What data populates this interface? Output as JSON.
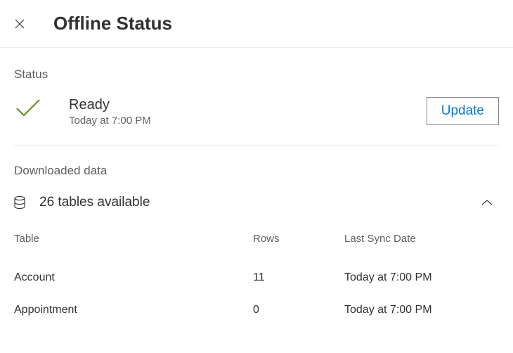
{
  "header": {
    "title": "Offline Status"
  },
  "status": {
    "label": "Status",
    "title": "Ready",
    "subtitle": "Today at 7:00 PM",
    "update_button": "Update"
  },
  "downloaded": {
    "label": "Downloaded data",
    "tables_summary": "26 tables available",
    "columns": {
      "table": "Table",
      "rows": "Rows",
      "sync": "Last Sync Date"
    },
    "rows": [
      {
        "name": "Account",
        "count": "11",
        "sync": "Today at 7:00 PM"
      },
      {
        "name": "Appointment",
        "count": "0",
        "sync": "Today at 7:00 PM"
      }
    ]
  },
  "colors": {
    "primary": "#0078d4",
    "checkmark": "#6b8e23"
  }
}
